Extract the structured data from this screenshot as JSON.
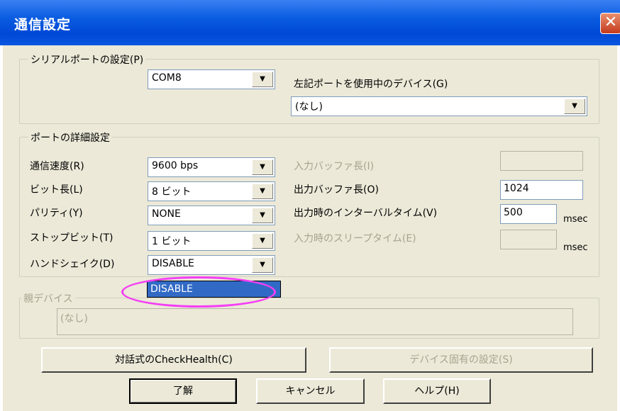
{
  "window": {
    "title": "通信設定",
    "close_glyph": "✕"
  },
  "serial_port": {
    "group_label": "シリアルポートの設定(P)",
    "port_value": "COM8",
    "device_label": "左記ポートを使用中のデバイス(G)",
    "device_value": "(なし)"
  },
  "port_details": {
    "group_label": "ポートの詳細設定",
    "baud_label": "通信速度(R)",
    "baud_value": "9600 bps",
    "bits_label": "ビット長(L)",
    "bits_value": "8 ビット",
    "parity_label": "パリティ(Y)",
    "parity_value": "NONE",
    "stop_label": "ストップビット(T)",
    "stop_value": "1 ビット",
    "handshake_label": "ハンドシェイク(D)",
    "handshake_value": "DISABLE",
    "handshake_option": "DISABLE",
    "in_buffer_label": "入力バッファ長(I)",
    "in_buffer_value": "",
    "out_buffer_label": "出力バッファ長(O)",
    "out_buffer_value": "1024",
    "out_interval_label": "出力時のインターバルタイム(V)",
    "out_interval_value": "500",
    "out_interval_unit": "msec",
    "in_sleep_label": "入力時のスリープタイム(E)",
    "in_sleep_value": "",
    "in_sleep_unit": "msec"
  },
  "parent_device": {
    "group_label": "親デバイス",
    "value": "(なし)"
  },
  "buttons": {
    "check_health": "対話式のCheckHealth(C)",
    "device_specific": "デバイス固有の設定(S)",
    "ok": "了解",
    "cancel": "キャンセル",
    "help": "ヘルプ(H)"
  },
  "arrow_glyph": "▼",
  "colors": {
    "titlebar": "#0a5ce0",
    "dialog_bg": "#ece9d8",
    "highlight": "#316ac5",
    "annotation": "#f43ef4"
  }
}
